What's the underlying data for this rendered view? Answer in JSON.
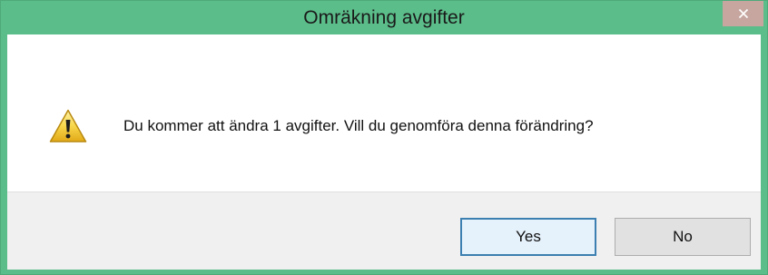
{
  "window": {
    "title": "Omräkning avgifter",
    "close_icon": "close-icon"
  },
  "message": {
    "icon": "warning-icon",
    "text": "Du kommer att ändra 1 avgifter. Vill du genomföra denna förändring?"
  },
  "buttons": {
    "yes_label": "Yes",
    "no_label": "No"
  },
  "colors": {
    "titlebar": "#5bbd8a",
    "close_button": "#c7a6a0",
    "button_area": "#f0f0f0",
    "default_button_border": "#3c7fb1"
  }
}
